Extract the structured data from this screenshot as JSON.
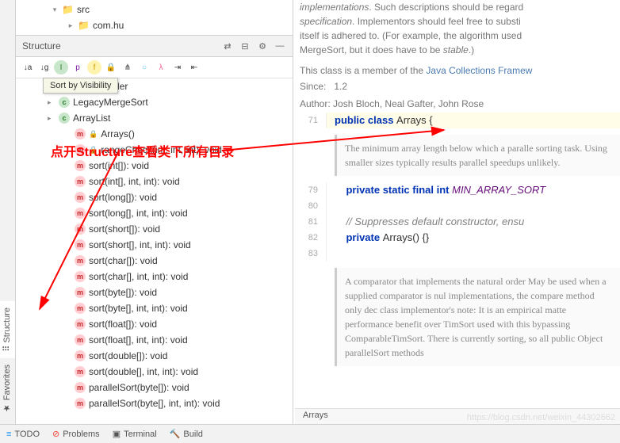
{
  "tree": {
    "folder1": "src",
    "folder2": "com.hu"
  },
  "structure": {
    "title": "Structure",
    "tooltip": "Sort by Visibility",
    "items": [
      {
        "exp": "▸",
        "kind": "c",
        "lock": "",
        "label": "NaturalOrder"
      },
      {
        "exp": "▸",
        "kind": "c",
        "lock": "",
        "label": "LegacyMergeSort"
      },
      {
        "exp": "▸",
        "kind": "c",
        "lock": "",
        "label": "ArrayList"
      },
      {
        "exp": "",
        "kind": "m",
        "lock": "🔒",
        "label": "Arrays()"
      },
      {
        "exp": "",
        "kind": "m",
        "lock": "🔒",
        "label": "rangeCheck(int, int, int): void"
      },
      {
        "exp": "",
        "kind": "m",
        "lock": "",
        "label": "sort(int[]): void"
      },
      {
        "exp": "",
        "kind": "m",
        "lock": "",
        "label": "sort(int[], int, int): void"
      },
      {
        "exp": "",
        "kind": "m",
        "lock": "",
        "label": "sort(long[]): void"
      },
      {
        "exp": "",
        "kind": "m",
        "lock": "",
        "label": "sort(long[], int, int): void"
      },
      {
        "exp": "",
        "kind": "m",
        "lock": "",
        "label": "sort(short[]): void"
      },
      {
        "exp": "",
        "kind": "m",
        "lock": "",
        "label": "sort(short[], int, int): void"
      },
      {
        "exp": "",
        "kind": "m",
        "lock": "",
        "label": "sort(char[]): void"
      },
      {
        "exp": "",
        "kind": "m",
        "lock": "",
        "label": "sort(char[], int, int): void"
      },
      {
        "exp": "",
        "kind": "m",
        "lock": "",
        "label": "sort(byte[]): void"
      },
      {
        "exp": "",
        "kind": "m",
        "lock": "",
        "label": "sort(byte[], int, int): void"
      },
      {
        "exp": "",
        "kind": "m",
        "lock": "",
        "label": "sort(float[]): void"
      },
      {
        "exp": "",
        "kind": "m",
        "lock": "",
        "label": "sort(float[], int, int): void"
      },
      {
        "exp": "",
        "kind": "m",
        "lock": "",
        "label": "sort(double[]): void"
      },
      {
        "exp": "",
        "kind": "m",
        "lock": "",
        "label": "sort(double[], int, int): void"
      },
      {
        "exp": "",
        "kind": "m",
        "lock": "",
        "label": "parallelSort(byte[]): void"
      },
      {
        "exp": "",
        "kind": "m",
        "lock": "",
        "label": "parallelSort(byte[], int, int): void"
      }
    ]
  },
  "doc": {
    "p1a": "implementations",
    "p1b": ". Such descriptions should be regard",
    "p2a": "specification",
    "p2b": ". Implementors should feel free to substi",
    "p3": "itself is adhered to. (For example, the algorithm used",
    "p4a": "MergeSort, but it does have to be ",
    "p4b": "stable",
    "p4c": ".)",
    "p5a": "This class is a member of the ",
    "p5b": "Java Collections Framew",
    "since_lbl": "Since:",
    "since_val": "1.2",
    "author_lbl": "Author:",
    "author_val": "Josh Bloch, Neal Gafter, John Rose"
  },
  "code": {
    "ln71": "71",
    "l71": {
      "a": "public ",
      "b": "class ",
      "c": "Arrays {"
    },
    "doc1": "The minimum array length below which a paralle sorting task. Using smaller sizes typically results parallel speedups unlikely.",
    "ln79": "79",
    "l79": {
      "a": "private static final int ",
      "b": "MIN_ARRAY_SORT"
    },
    "ln80": "80",
    "ln81": "81",
    "ln82": "82",
    "ln83": "83",
    "l81": "// Suppresses default constructor, ensu",
    "l82": {
      "a": "private ",
      "b": "Arrays() {}"
    },
    "doc2": "A comparator that implements the natural order May be used when a supplied comparator is nul implementations, the compare method only dec class implementor's note: It is an empirical matte performance benefit over TimSort used with this bypassing ComparableTimSort. There is currently sorting, so all public Object parallelSort methods"
  },
  "breadcrumb": "Arrays",
  "bottom": {
    "todo": "TODO",
    "problems": "Problems",
    "terminal": "Terminal",
    "build": "Build"
  },
  "side": {
    "structure": "Structure",
    "favorites": "Favorites"
  },
  "annotation": "点开Structure查看类下所有目录",
  "watermark": "https://blog.csdn.net/weixin_44302662"
}
